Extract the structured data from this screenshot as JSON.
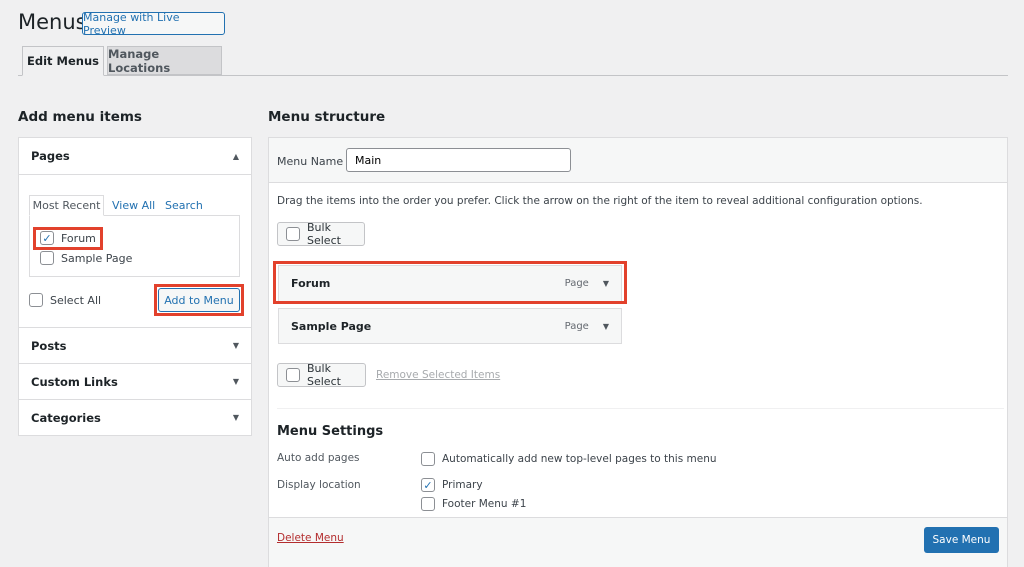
{
  "header": {
    "title": "Menus",
    "live_preview": "Manage with Live Preview"
  },
  "tabs": [
    {
      "label": "Edit Menus",
      "active": true
    },
    {
      "label": "Manage Locations",
      "active": false
    }
  ],
  "left": {
    "title": "Add menu items",
    "pages": {
      "label": "Pages",
      "tabs": [
        "Most Recent",
        "View All",
        "Search"
      ],
      "items": [
        {
          "label": "Forum",
          "checked": true
        },
        {
          "label": "Sample Page",
          "checked": false
        }
      ],
      "select_all": "Select All",
      "add_button": "Add to Menu"
    },
    "sections": [
      "Posts",
      "Custom Links",
      "Categories"
    ]
  },
  "right": {
    "title": "Menu structure",
    "menu_name_label": "Menu Name",
    "menu_name_value": "Main",
    "instructions": "Drag the items into the order you prefer. Click the arrow on the right of the item to reveal additional configuration options.",
    "bulk_select": "Bulk Select",
    "items": [
      {
        "label": "Forum",
        "type": "Page"
      },
      {
        "label": "Sample Page",
        "type": "Page"
      }
    ],
    "remove_selected": "Remove Selected Items",
    "settings": {
      "title": "Menu Settings",
      "auto_add_label": "Auto add pages",
      "auto_add_text": "Automatically add new top-level pages to this menu",
      "display_location_label": "Display location",
      "locations": [
        {
          "label": "Primary",
          "checked": true
        },
        {
          "label": "Footer Menu #1",
          "checked": false
        }
      ]
    },
    "delete_menu": "Delete Menu",
    "save_menu": "Save Menu"
  },
  "colors": {
    "accent": "#2271b1",
    "highlight": "#e2412c",
    "delete": "#b32d2e"
  }
}
